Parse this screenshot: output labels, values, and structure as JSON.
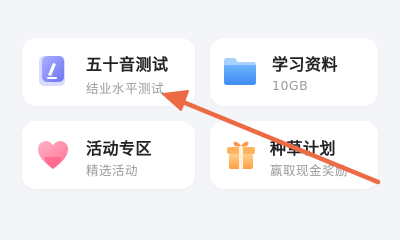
{
  "cards": [
    {
      "title": "五十音测试",
      "subtitle": "结业水平测试",
      "icon": "test-document-icon"
    },
    {
      "title": "学习资料",
      "subtitle": "10GB",
      "icon": "folder-icon"
    },
    {
      "title": "活动专区",
      "subtitle": "精选活动",
      "icon": "heart-icon"
    },
    {
      "title": "种草计划",
      "subtitle": "赢取现金奖励",
      "icon": "gift-box-icon"
    }
  ],
  "colors": {
    "background": "#f4f5f8",
    "card": "#ffffff",
    "title_text": "#222222",
    "subtitle_text": "#9b9b9b",
    "annotation_arrow": "#ec6a44"
  }
}
